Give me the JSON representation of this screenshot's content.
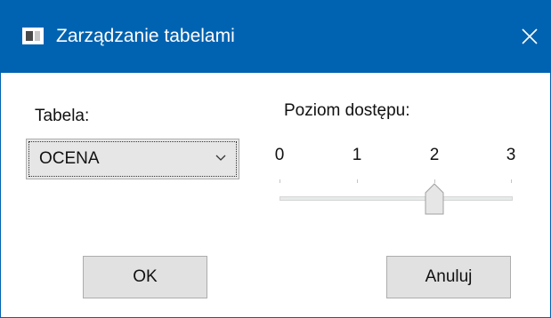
{
  "window": {
    "title": "Zarządzanie tabelami",
    "accent_color": "#0063b1",
    "icons": {
      "app": "app-window-icon",
      "close": "close-icon"
    }
  },
  "form": {
    "table_label": "Tabela:",
    "table_selected": "OCENA",
    "access_label": "Poziom dostępu:",
    "slider": {
      "min": 0,
      "max": 3,
      "value": 2,
      "ticks": [
        "0",
        "1",
        "2",
        "3"
      ]
    }
  },
  "buttons": {
    "ok": "OK",
    "cancel": "Anuluj"
  }
}
